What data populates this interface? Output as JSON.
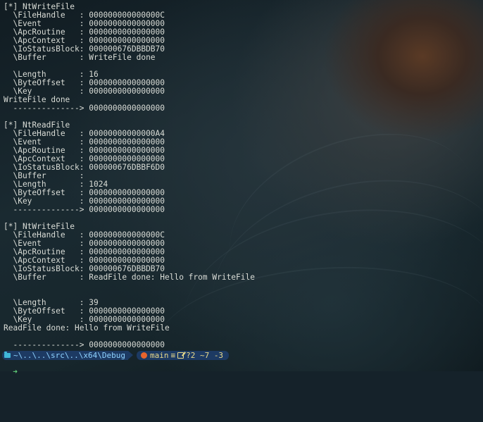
{
  "terminal": {
    "lines": [
      "[*] NtWriteFile",
      "  \\FileHandle   : 000000000000000C",
      "  \\Event        : 0000000000000000",
      "  \\ApcRoutine   : 0000000000000000",
      "  \\ApcContext   : 0000000000000000",
      "  \\IoStatusBlock: 000000676DBBDB70",
      "  \\Buffer       : WriteFile done",
      "",
      "  \\Length       : 16",
      "  \\ByteOffset   : 0000000000000000",
      "  \\Key          : 0000000000000000",
      "WriteFile done",
      "  --------------> 0000000000000000",
      "",
      "[*] NtReadFile",
      "  \\FileHandle   : 00000000000000A4",
      "  \\Event        : 0000000000000000",
      "  \\ApcRoutine   : 0000000000000000",
      "  \\ApcContext   : 0000000000000000",
      "  \\IoStatusBlock: 000000676DBBF6D0",
      "  \\Buffer       :",
      "  \\Length       : 1024",
      "  \\ByteOffset   : 0000000000000000",
      "  \\Key          : 0000000000000000",
      "  --------------> 0000000000000000",
      "",
      "[*] NtWriteFile",
      "  \\FileHandle   : 000000000000000C",
      "  \\Event        : 0000000000000000",
      "  \\ApcRoutine   : 0000000000000000",
      "  \\ApcContext   : 0000000000000000",
      "  \\IoStatusBlock: 000000676DBBDB70",
      "  \\Buffer       : ReadFile done: Hello from WriteFile",
      "",
      "",
      "  \\Length       : 39",
      "  \\ByteOffset   : 0000000000000000",
      "  \\Key          : 0000000000000000",
      "ReadFile done: Hello from WriteFile",
      "",
      "  --------------> 0000000000000000"
    ]
  },
  "prompt": {
    "path": "~\\..\\..\\src\\..\\x64\\Debug",
    "branch": "main",
    "branch_sep": "≡",
    "status": "?2 ~7 -3",
    "cursor": "➜"
  },
  "icons": {
    "folder": "folder-icon",
    "branch": "git-branch-icon",
    "edit": "edit-icon"
  },
  "colors": {
    "text": "#d9dcd6",
    "segment_bg": "#1d3a63",
    "path_text": "#8fd3ff",
    "git_text": "#e9d98a",
    "cursor": "#62d27a"
  }
}
